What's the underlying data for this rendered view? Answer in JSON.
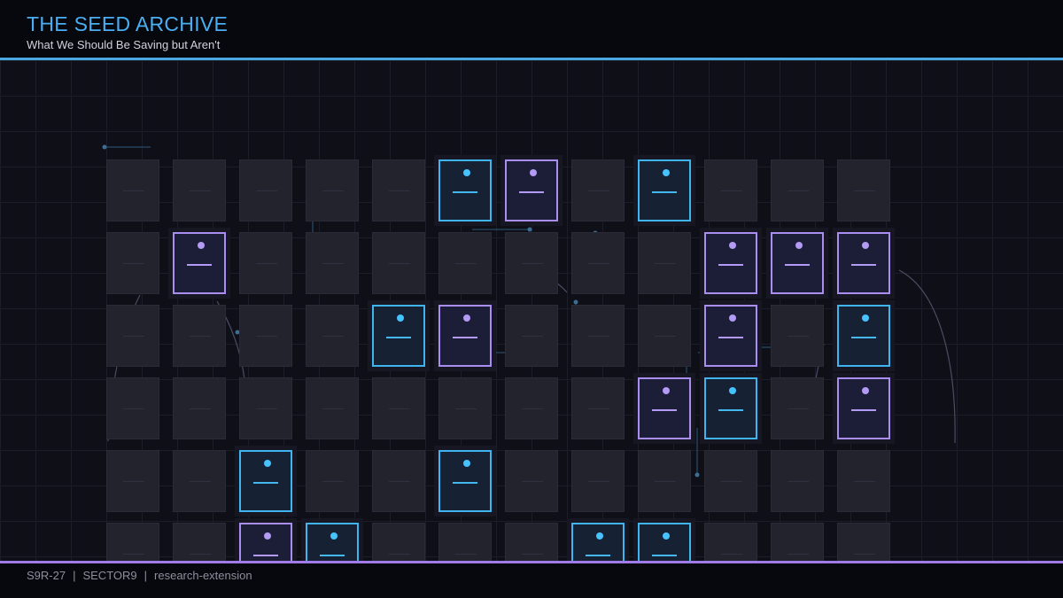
{
  "header": {
    "title": "THE SEED ARCHIVE",
    "subtitle": "What We Should Be Saving but Aren't"
  },
  "footer": {
    "code": "S9R-27",
    "sector": "SECTOR9",
    "tag": "research-extension",
    "separator": "|"
  },
  "colors": {
    "accent_cyan": "#3fb4ee",
    "accent_violet": "#a98ef0",
    "empty_cell": "#22232d",
    "background": "#0e0f17"
  },
  "grid": {
    "columns": 12,
    "rows": 6,
    "saved_cells": [
      {
        "row": 0,
        "col": 5,
        "color": "cyan"
      },
      {
        "row": 0,
        "col": 6,
        "color": "violet"
      },
      {
        "row": 0,
        "col": 8,
        "color": "cyan"
      },
      {
        "row": 1,
        "col": 1,
        "color": "violet"
      },
      {
        "row": 1,
        "col": 9,
        "color": "violet"
      },
      {
        "row": 1,
        "col": 10,
        "color": "violet"
      },
      {
        "row": 1,
        "col": 11,
        "color": "violet"
      },
      {
        "row": 2,
        "col": 4,
        "color": "cyan"
      },
      {
        "row": 2,
        "col": 5,
        "color": "violet"
      },
      {
        "row": 2,
        "col": 9,
        "color": "violet"
      },
      {
        "row": 2,
        "col": 11,
        "color": "cyan"
      },
      {
        "row": 3,
        "col": 8,
        "color": "violet"
      },
      {
        "row": 3,
        "col": 9,
        "color": "cyan"
      },
      {
        "row": 3,
        "col": 11,
        "color": "violet"
      },
      {
        "row": 4,
        "col": 2,
        "color": "cyan"
      },
      {
        "row": 4,
        "col": 5,
        "color": "cyan"
      },
      {
        "row": 5,
        "col": 2,
        "color": "violet"
      },
      {
        "row": 5,
        "col": 3,
        "color": "cyan"
      },
      {
        "row": 5,
        "col": 7,
        "color": "cyan"
      },
      {
        "row": 5,
        "col": 8,
        "color": "cyan"
      }
    ]
  }
}
